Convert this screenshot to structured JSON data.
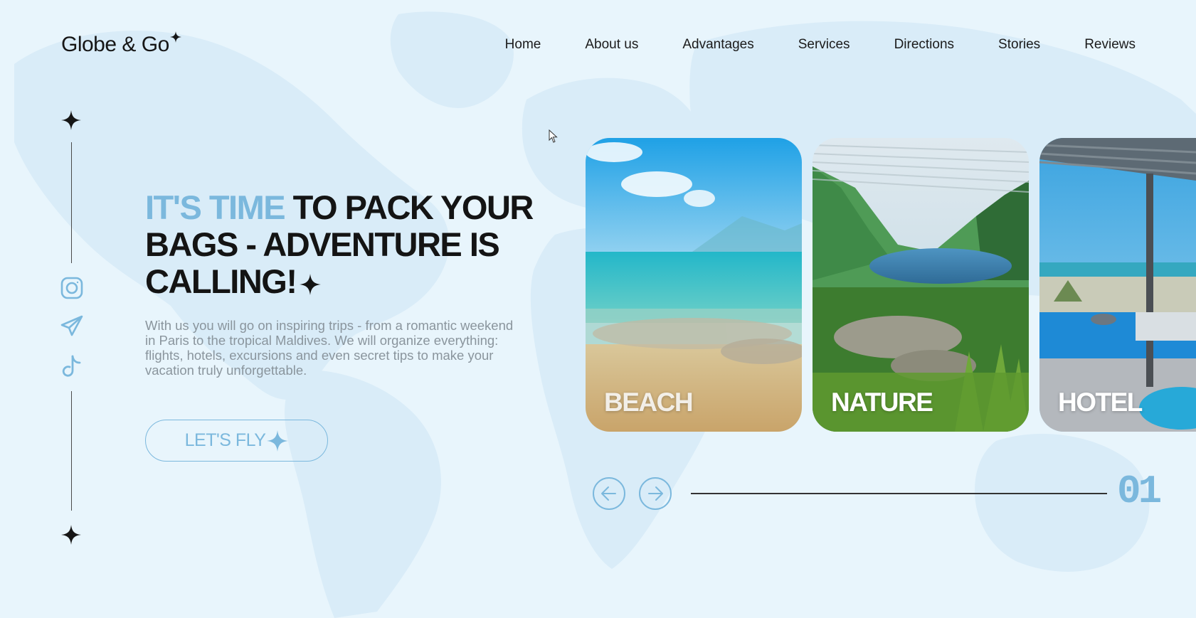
{
  "brand": {
    "name": "Globe & Go"
  },
  "nav": {
    "items": [
      "Home",
      "About us",
      "Advantages",
      "Services",
      "Directions",
      "Stories",
      "Reviews"
    ]
  },
  "social": [
    "instagram-icon",
    "telegram-icon",
    "tiktok-icon"
  ],
  "hero": {
    "title_accent": "IT'S TIME",
    "title_rest": " TO PACK YOUR BAGS - ADVENTURE IS CALLING!",
    "description": "With us you will go on inspiring trips - from a romantic weekend in Paris to the tropical Maldives. We will organize everything: flights, hotels, excursions and even secret tips to make your vacation truly unforgettable.",
    "cta_label": "LET'S FLY"
  },
  "cards": [
    {
      "label": "BEACH"
    },
    {
      "label": "NATURE"
    },
    {
      "label": "HOTEL"
    }
  ],
  "slider": {
    "counter": "01"
  },
  "colors": {
    "accent": "#7bb8dd",
    "background": "#e8f5fc",
    "text": "#141414",
    "muted": "#8a959d"
  }
}
